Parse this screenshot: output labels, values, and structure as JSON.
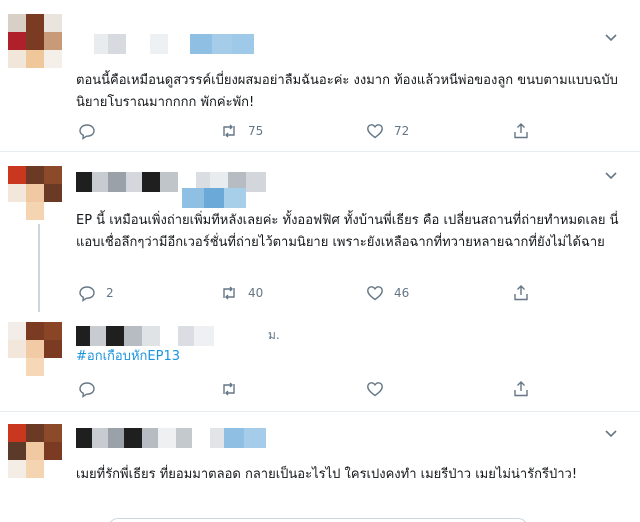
{
  "tweets": [
    {
      "text": "ตอนนี้คือเหมือนดูสวรรค์เบี่ยงผสมอย่าลืมฉันอะค่ะ งงมาก ท้องแล้วหนีพ่อของลูก ขนบตามแบบฉบับนิยายโบราณมากกกก พักค่ะพัก!",
      "replies": "",
      "retweets": "75",
      "likes": "72"
    },
    {
      "text": "EP นี้ เหมือนเพิ่งถ่ายเพิ่มทีหลังเลยค่ะ ทั้งออฟฟิศ ทั้งบ้านพี่เธียร คือ เปลี่ยนสถานที่ถ่ายทำหมดเลย นี่แอบเชื่อลึกๆว่ามีอีกเวอร์ชั่นที่ถ่ายไว้ตามนิยาย เพราะยังเหลือฉากที่ทวายหลายฉากที่ยังไม่ได้ฉาย",
      "replies": "2",
      "retweets": "40",
      "likes": "46"
    },
    {
      "time_suffix": "ม.",
      "hashtag": "#อกเกือบหักEP13",
      "replies": "",
      "retweets": "",
      "likes": ""
    },
    {
      "text": "เมยที่รักพี่เธียร ที่ยอมมาตลอด กลายเป็นอะไรไป ใครเปงคงทำ เมยรีป่าว เมยไม่น่ารักรีป่าว!"
    }
  ],
  "icons": {
    "reply": "reply-icon",
    "retweet": "retweet-icon",
    "like": "heart-icon",
    "share": "share-icon",
    "menu": "chevron-down-icon"
  },
  "colors": {
    "accent": "#1b95e0",
    "muted": "#657786",
    "divider": "#e6ecf0"
  }
}
